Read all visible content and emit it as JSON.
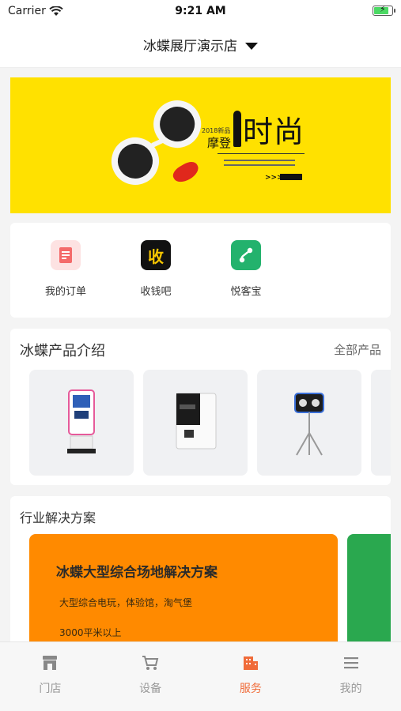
{
  "status": {
    "carrier": "Carrier",
    "time": "9:21 AM"
  },
  "nav": {
    "title": "冰蝶展厅演示店"
  },
  "banner": {
    "year_text": "2018新品",
    "subtitle": "摩登",
    "main": "时尚",
    "arrows": ">>>"
  },
  "quick": {
    "items": [
      {
        "label": "我的订单",
        "icon": "order-icon",
        "color": "#f46a6a"
      },
      {
        "label": "收钱吧",
        "icon": "shouqianba-icon",
        "glyph": "收",
        "color": "#111111"
      },
      {
        "label": "悦客宝",
        "icon": "yuekebao-icon",
        "color": "#23b26d"
      }
    ]
  },
  "products": {
    "title": "冰蝶产品介绍",
    "more": "全部产品"
  },
  "solutions": {
    "title": "行业解决方案",
    "cards": [
      {
        "title": "冰蝶大型综合场地解决方案",
        "desc1": "大型综合电玩，体验馆，淘气堡",
        "desc2": "3000平米以上",
        "color": "#ff8a00"
      }
    ],
    "next_card_color": "#2aa84f"
  },
  "tabbar": {
    "tabs": [
      {
        "label": "门店",
        "icon": "store-icon"
      },
      {
        "label": "设备",
        "icon": "cart-icon"
      },
      {
        "label": "服务",
        "icon": "building-icon",
        "active": true
      },
      {
        "label": "我的",
        "icon": "menu-icon"
      }
    ],
    "active_color": "#f06c3a",
    "inactive_color": "#999999"
  }
}
